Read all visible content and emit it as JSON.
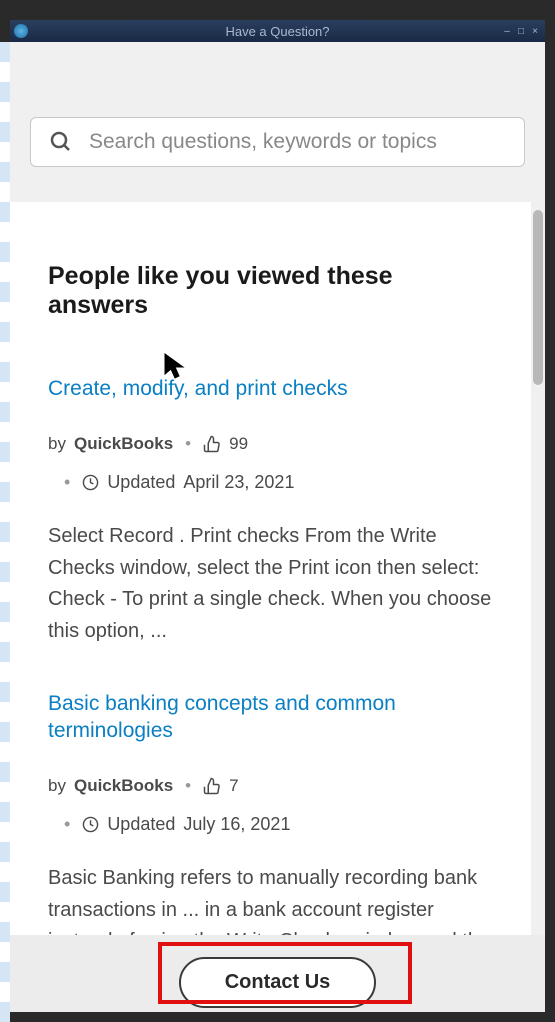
{
  "window": {
    "title": "Have a Question?"
  },
  "search": {
    "placeholder": "Search questions, keywords or topics"
  },
  "section": {
    "heading": "People like you viewed these answers"
  },
  "articles": [
    {
      "title": "Create, modify, and print checks",
      "by_label": "by",
      "author": "QuickBooks",
      "likes": "99",
      "updated_label": "Updated",
      "updated_date": "April 23, 2021",
      "excerpt": "Select Record . Print checks From the Write Checks window, select the Print icon then select: Check - To print a single check. When you choose this option, ..."
    },
    {
      "title": "Basic banking concepts and common terminologies",
      "by_label": "by",
      "author": "QuickBooks",
      "likes": "7",
      "updated_label": "Updated",
      "updated_date": "July 16, 2021",
      "excerpt": "Basic Banking refers to manually recording bank transactions in ... in a bank account register instead of using the Write Checks window and the Make ..."
    }
  ],
  "footer": {
    "contact_label": "Contact Us"
  }
}
